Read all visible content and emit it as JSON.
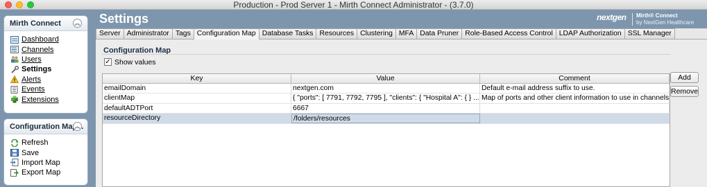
{
  "window": {
    "title": "Production - Prod Server 1 - Mirth Connect Administrator - (3.7.0)"
  },
  "sidebar": {
    "title": "Mirth Connect",
    "items": [
      {
        "label": "Dashboard",
        "icon": "dashboard-icon"
      },
      {
        "label": "Channels",
        "icon": "channels-icon"
      },
      {
        "label": "Users",
        "icon": "users-icon"
      },
      {
        "label": "Settings",
        "icon": "wrench-icon",
        "active": true
      },
      {
        "label": "Alerts",
        "icon": "warning-icon"
      },
      {
        "label": "Events",
        "icon": "events-icon"
      },
      {
        "label": "Extensions",
        "icon": "puzzle-icon"
      }
    ]
  },
  "tasks": {
    "title": "Configuration Map...",
    "items": [
      {
        "label": "Refresh",
        "icon": "refresh-icon"
      },
      {
        "label": "Save",
        "icon": "save-icon"
      },
      {
        "label": "Import Map",
        "icon": "import-icon"
      },
      {
        "label": "Export Map",
        "icon": "export-icon"
      }
    ]
  },
  "header": {
    "title": "Settings",
    "brand_logo": "nextgen",
    "brand_name": "Mirth® Connect",
    "brand_sub": "by NextGen Healthcare"
  },
  "tabs": [
    "Server",
    "Administrator",
    "Tags",
    "Configuration Map",
    "Database Tasks",
    "Resources",
    "Clustering",
    "MFA",
    "Data Pruner",
    "Role-Based Access Control",
    "LDAP Authorization",
    "SSL Manager"
  ],
  "active_tab": "Configuration Map",
  "config": {
    "section_title": "Configuration Map",
    "show_values_label": "Show values",
    "show_values_checked": "✓",
    "columns": [
      "Key",
      "Value",
      "Comment"
    ],
    "rows": [
      [
        "emailDomain",
        "nextgen.com",
        "Default e-mail address suffix to use."
      ],
      [
        "clientMap",
        "{  \"ports\":  [    7791,   7792,   7795  ],  \"clients\":  {    \"Hospital A\":  {   }  ...",
        "Map of ports and other client information to use in channels."
      ],
      [
        "defaultADTPort",
        "6667",
        ""
      ],
      [
        "resourceDirectory",
        "/folders/resources",
        ""
      ]
    ],
    "selected_row": 3,
    "add_label": "Add",
    "remove_label": "Remove"
  },
  "colors": {
    "background": "#7d96ad",
    "selection": "#cfdbe7"
  }
}
